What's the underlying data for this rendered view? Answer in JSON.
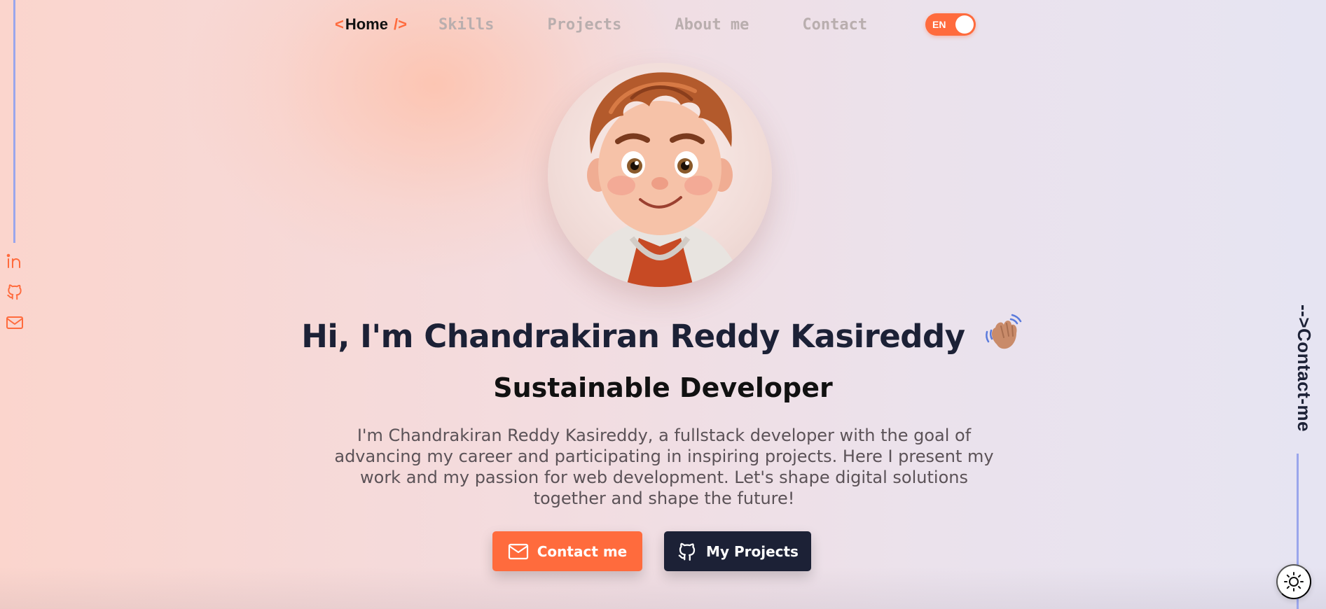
{
  "nav": {
    "home_open": "<",
    "home_label": "Home",
    "home_close": "/>",
    "items": [
      "Skills",
      "Projects",
      "About me",
      "Contact"
    ],
    "lang_label": "EN"
  },
  "hero": {
    "headline": "Hi, I'm Chandrakiran Reddy Kasireddy",
    "subtitle": "Sustainable Developer",
    "description": "I'm Chandrakiran Reddy Kasireddy, a fullstack developer with the goal of advancing my career and participating in inspiring projects. Here I present my work and my passion for web development. Let's shape digital solutions together and shape the future!"
  },
  "buttons": {
    "contact_label": "Contact me",
    "projects_label": "My Projects"
  },
  "side": {
    "contact_vertical": "-->Contact-me"
  },
  "colors": {
    "accent": "#ff6b3d",
    "dark": "#1c2136",
    "line": "#9aa6ec"
  },
  "icons": {
    "social": [
      "linkedin-icon",
      "github-icon",
      "mail-icon"
    ],
    "theme": "sun-icon",
    "wave": "waving-hand-icon"
  }
}
